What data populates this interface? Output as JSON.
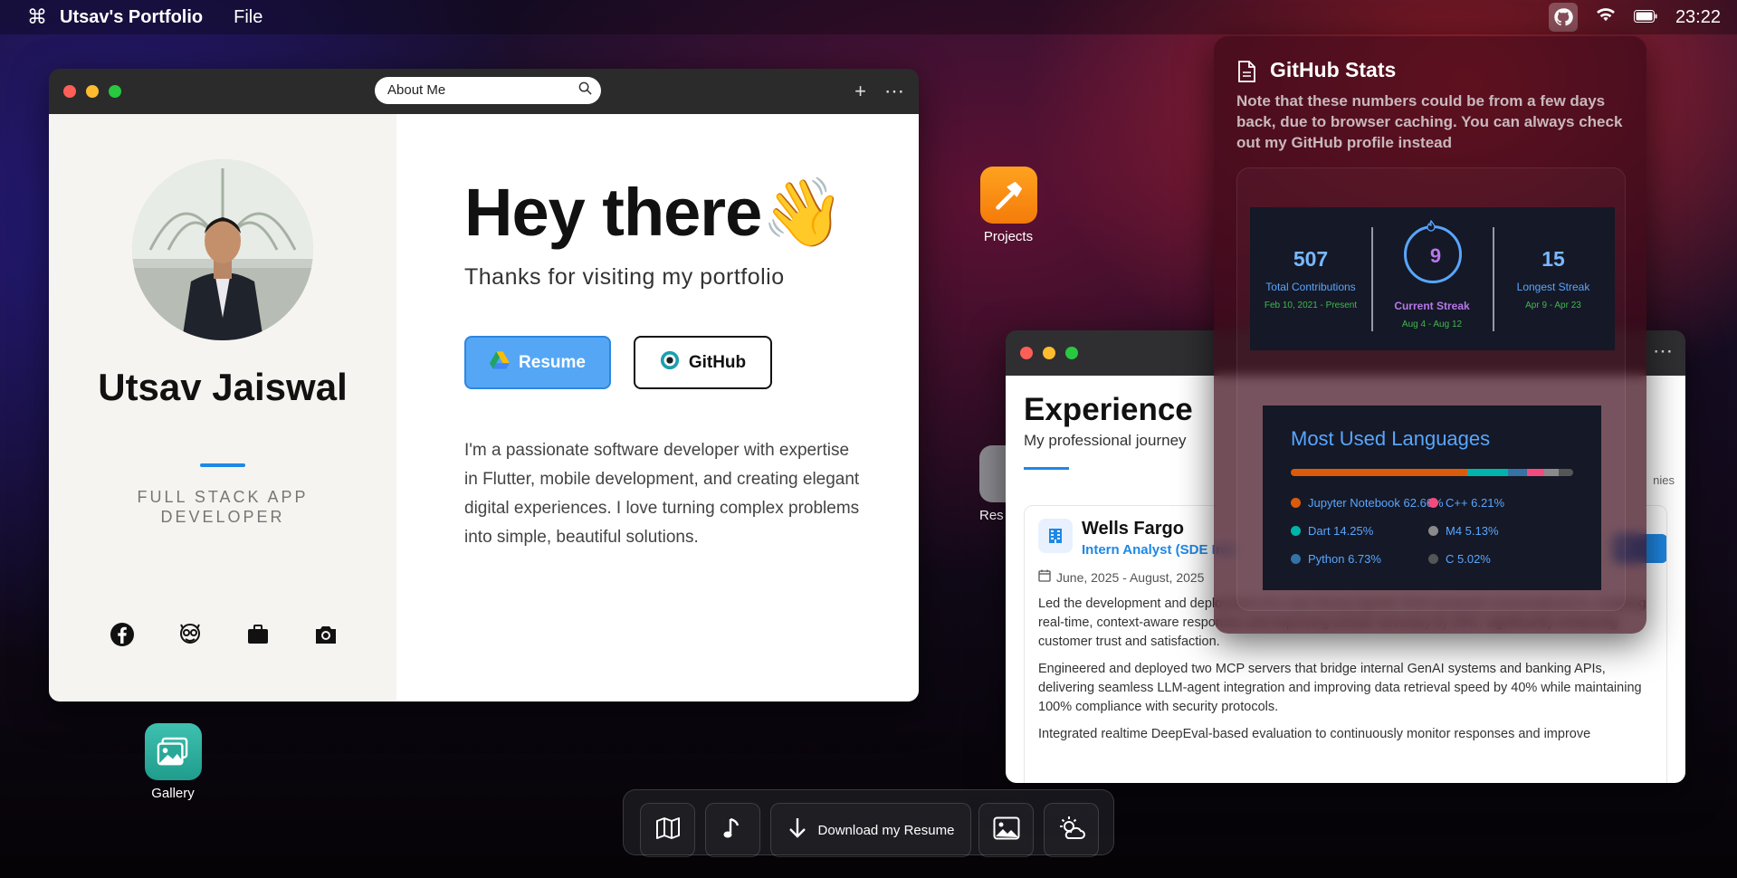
{
  "menubar": {
    "logo": "⌘",
    "app_name": "Utsav's Portfolio",
    "file_menu": "File",
    "time": "23:22"
  },
  "about_window": {
    "url": "About Me",
    "left": {
      "name": "Utsav Jaiswal",
      "role": "FULL STACK APP DEVELOPER"
    },
    "right": {
      "greeting": "Hey there",
      "wave": "👋",
      "subtitle": "Thanks for visiting my portfolio",
      "resume_button": "Resume",
      "github_button": "GitHub",
      "bio": "I'm a passionate software developer with expertise in Flutter, mobile development, and creating elegant digital experiences. I love turning complex problems into simple, beautiful solutions."
    }
  },
  "desktop": {
    "projects": "Projects",
    "gallery": "Gallery",
    "resume_partial": "Res"
  },
  "experience_window": {
    "title": "Experience",
    "subtitle": "My professional journey",
    "card": {
      "company": "Wells Fargo",
      "role": "Intern Analyst (SDE Inte",
      "dates": "June, 2025 - August, 2025",
      "bullets": [
        "Led the development and deployment of a user-facing Agentic RAG-powered conversational AI, enabling real-time, context-aware responses and improving answer accuracy by 25%, significantly enhancing customer trust and satisfaction.",
        "Engineered and deployed two MCP servers that bridge internal GenAI systems and banking APIs, delivering seamless LLM-agent integration and improving data retrieval speed by 40% while maintaining 100% compliance with security protocols.",
        "Integrated realtime DeepEval-based evaluation to continuously monitor responses and improve"
      ]
    },
    "fragment_text": "nies",
    "fragment_button": "h"
  },
  "github_stats": {
    "title": "GitHub Stats",
    "note": "Note that these numbers could be from a few days back, due to browser caching. You can always check out my GitHub profile instead",
    "streak": {
      "total": {
        "value": "507",
        "label": "Total Contributions",
        "range": "Feb 10, 2021 - Present"
      },
      "current": {
        "value": "9",
        "label": "Current Streak",
        "range": "Aug 4 - Aug 12"
      },
      "longest": {
        "value": "15",
        "label": "Longest Streak",
        "range": "Apr 9 - Apr 23"
      }
    },
    "languages": {
      "title": "Most Used Languages",
      "items": [
        {
          "name": "Jupyter Notebook",
          "pct": 62.66,
          "label": "Jupyter Notebook 62.66%",
          "color": "#DA5B0B"
        },
        {
          "name": "Dart",
          "pct": 14.25,
          "label": "Dart 14.25%",
          "color": "#00B4AB"
        },
        {
          "name": "Python",
          "pct": 6.73,
          "label": "Python 6.73%",
          "color": "#3572A5"
        },
        {
          "name": "C++",
          "pct": 6.21,
          "label": "C++ 6.21%",
          "color": "#F34B7D"
        },
        {
          "name": "M4",
          "pct": 5.13,
          "label": "M4 5.13%",
          "color": "#8a8a8a"
        },
        {
          "name": "C",
          "pct": 5.02,
          "label": "C 5.02%",
          "color": "#555555"
        }
      ]
    }
  },
  "dock": {
    "download_label": "Download my Resume",
    "icons": [
      "map-icon",
      "music-icon",
      "download-icon",
      "image-icon",
      "weather-icon"
    ]
  }
}
